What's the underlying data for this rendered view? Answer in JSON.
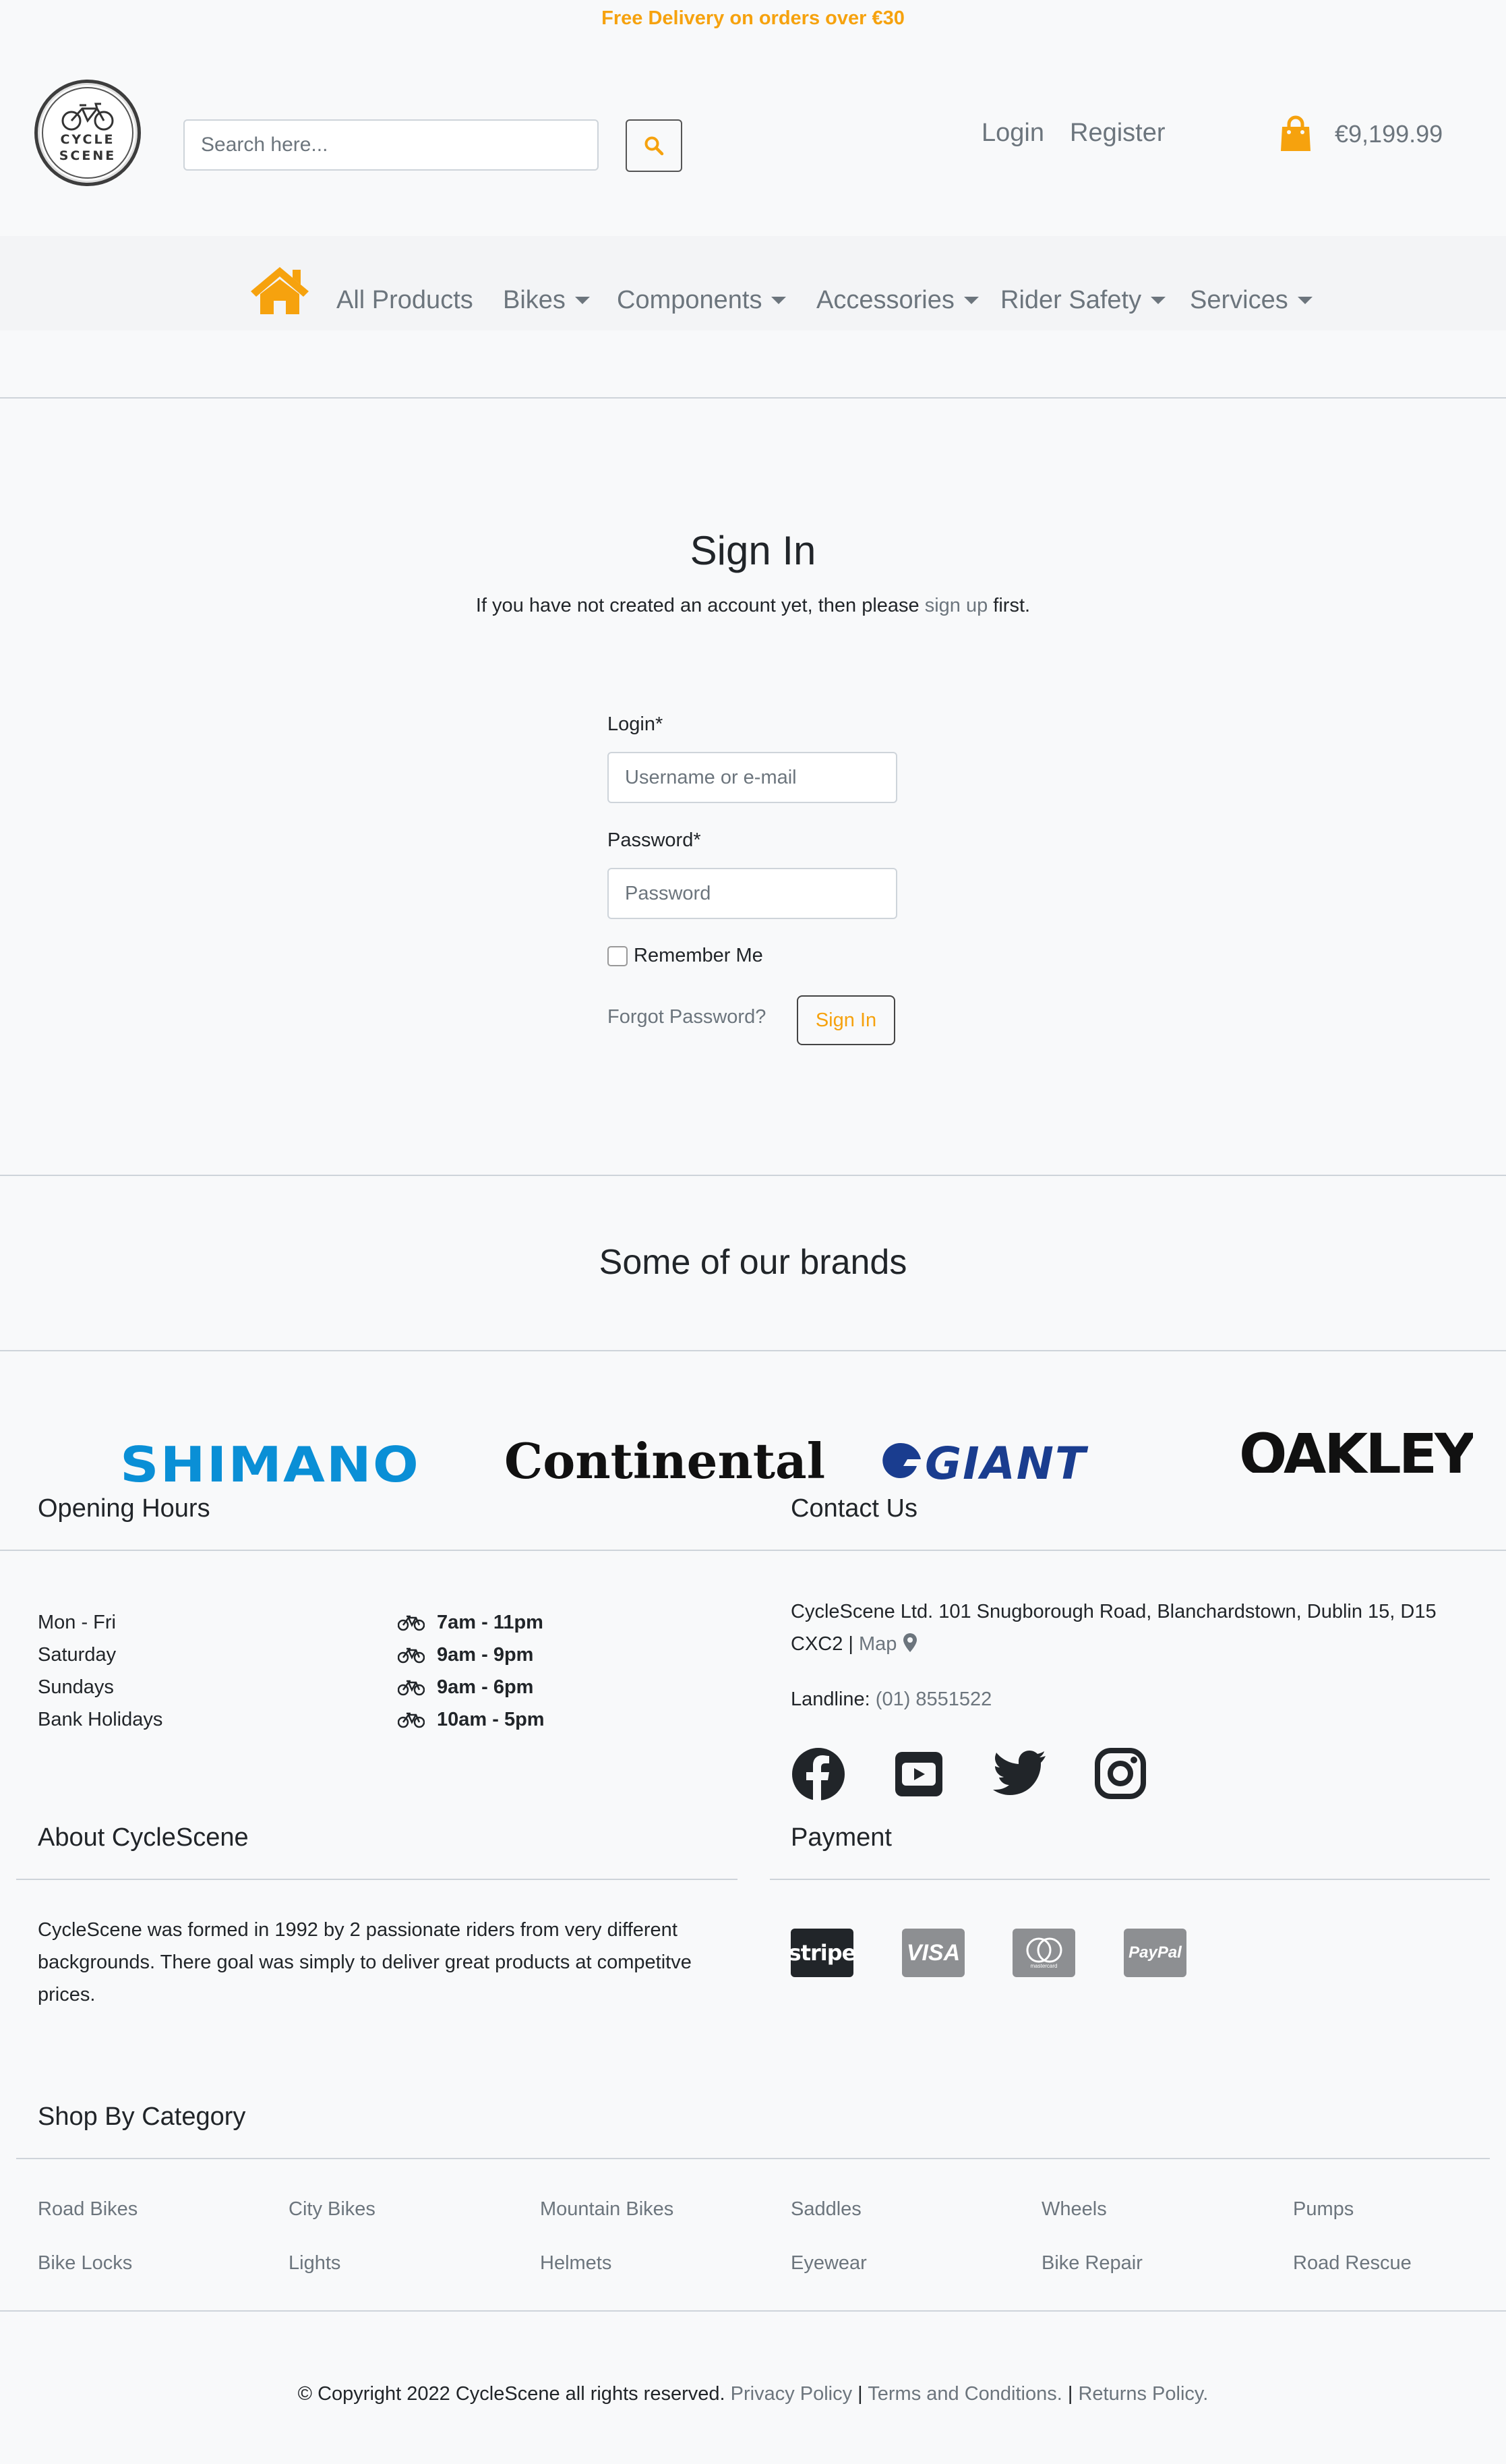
{
  "banner": {
    "text": "Free Delivery on orders over €30"
  },
  "logo": {
    "line1": "CYCLE",
    "line2": "SCENE"
  },
  "search": {
    "placeholder": "Search here..."
  },
  "header": {
    "login": "Login",
    "register": "Register",
    "cart_total": "€9,199.99"
  },
  "nav": {
    "items": [
      {
        "label": "All Products"
      },
      {
        "label": "Bikes"
      },
      {
        "label": "Components"
      },
      {
        "label": "Accessories"
      },
      {
        "label": "Rider Safety"
      },
      {
        "label": "Services"
      }
    ]
  },
  "signin": {
    "title": "Sign In",
    "sub_before": "If you have not created an account yet, then please ",
    "sub_link": "sign up",
    "sub_after": " first.",
    "login_label": "Login*",
    "login_placeholder": "Username or e-mail",
    "password_label": "Password*",
    "password_placeholder": "Password",
    "remember": "Remember Me",
    "forgot": "Forgot Password?",
    "button": "Sign In"
  },
  "brands": {
    "title": "Some of our brands",
    "names": [
      "SHIMANO",
      "Continental",
      "GIANT",
      "OAKLEY"
    ]
  },
  "hours": {
    "title": "Opening Hours",
    "rows": [
      {
        "day": "Mon - Fri",
        "time": "7am - 11pm"
      },
      {
        "day": "Saturday",
        "time": "9am - 9pm"
      },
      {
        "day": "Sundays",
        "time": "9am - 6pm"
      },
      {
        "day": "Bank Holidays",
        "time": "10am - 5pm"
      }
    ]
  },
  "contact": {
    "title": "Contact Us",
    "address_line1": "CycleScene Ltd. 101 Snugborough Road, Blanchardstown, Dublin 15, D15",
    "address_line2": "CXC2 | ",
    "map": "Map",
    "landline_label": "Landline: ",
    "landline": "(01) 8551522"
  },
  "about": {
    "title": "About CycleScene",
    "text": "CycleScene was formed in 1992 by 2 passionate riders from very different backgrounds. There goal was simply to deliver great products at competitve prices."
  },
  "payment": {
    "title": "Payment",
    "methods": [
      "stripe",
      "VISA",
      "mastercard",
      "PayPal"
    ]
  },
  "categories": {
    "title": "Shop By Category",
    "items": [
      "Road Bikes",
      "City Bikes",
      "Mountain Bikes",
      "Saddles",
      "Wheels",
      "Pumps",
      "Bike Locks",
      "Lights",
      "Helmets",
      "Eyewear",
      "Bike Repair",
      "Road Rescue"
    ]
  },
  "footer": {
    "copyright": "© Copyright 2022 CycleScene all rights reserved. ",
    "privacy": "Privacy Policy",
    "terms": "Terms and Conditions.",
    "returns": "Returns Policy."
  },
  "colors": {
    "accent": "#f6a20e",
    "muted": "#6c757d",
    "text": "#212529"
  }
}
